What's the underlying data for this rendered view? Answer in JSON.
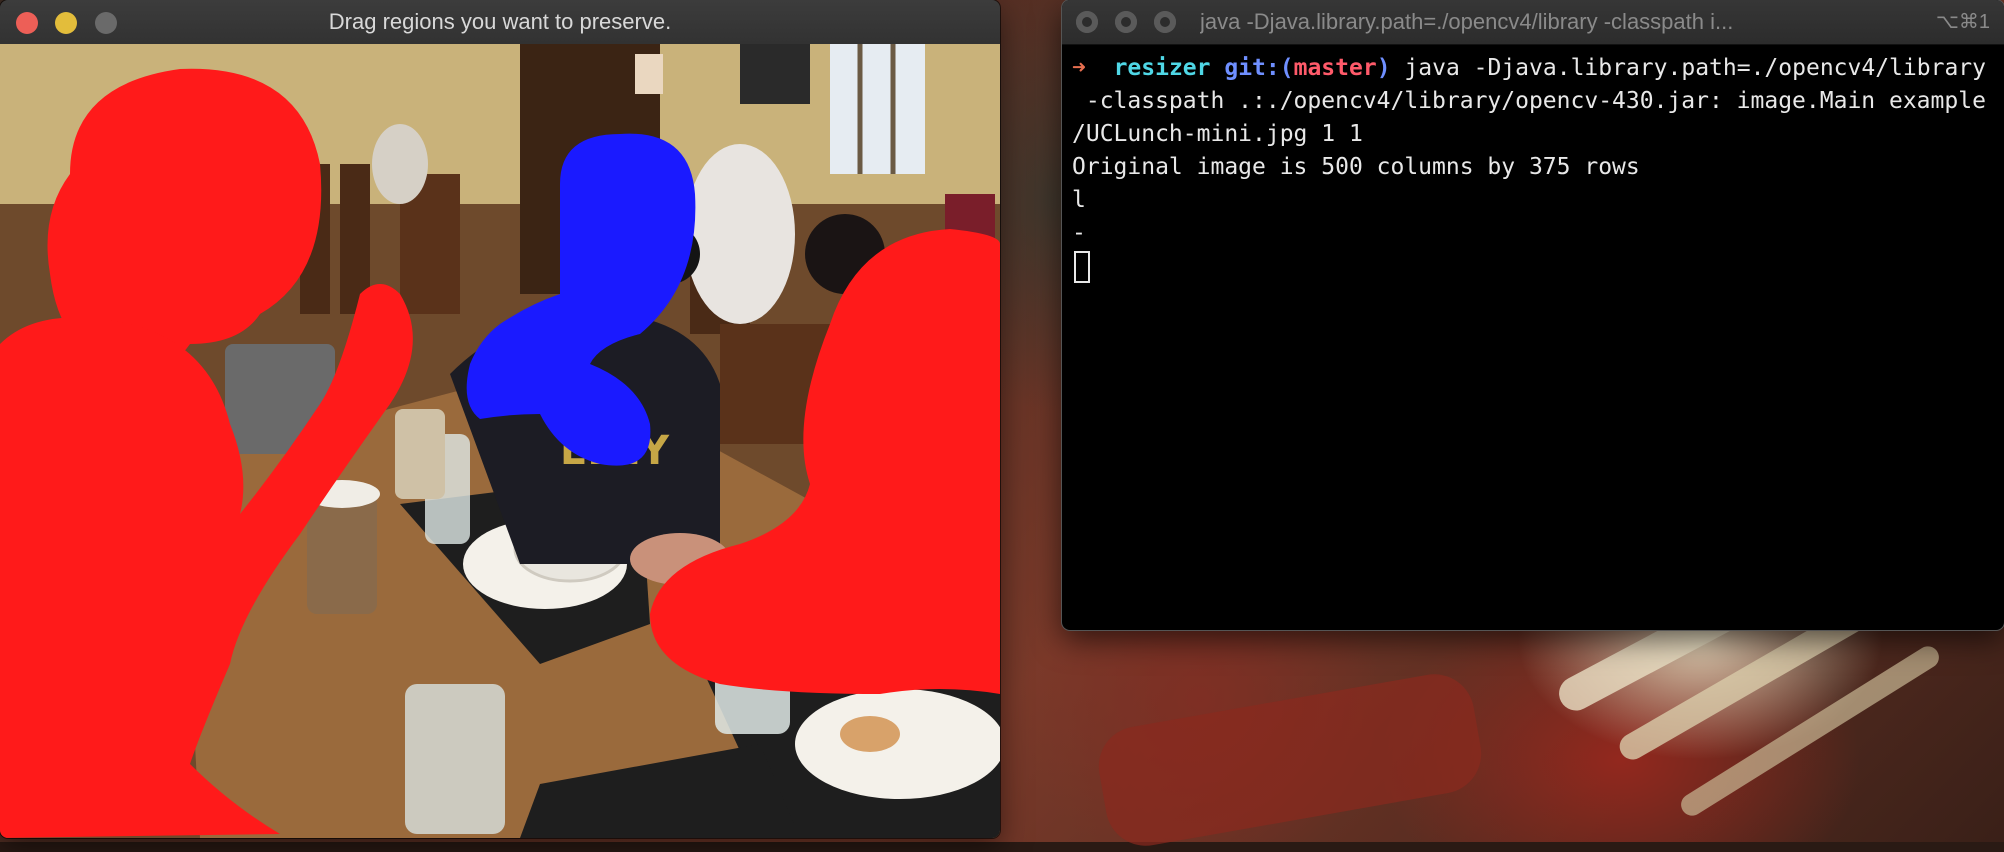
{
  "image_window": {
    "title": "Drag regions you want to preserve.",
    "traffic_colors": {
      "close": "#ed5f57",
      "minimize": "#e3bd3b",
      "zoom": "#6a6a6a"
    },
    "mask_colors": {
      "preserve": "#ff1a1a",
      "remove": "#1a1aff"
    }
  },
  "terminal": {
    "title": "java -Djava.library.path=./opencv4/library -classpath  i...",
    "shortcut": "⌥⌘1",
    "prompt": {
      "arrow": "➜",
      "directory": "resizer",
      "git_label": "git:(",
      "branch": "master",
      "git_close": ")"
    },
    "lines": [
      " java -Djava.library.path=./opencv4/library",
      " -classpath .:./opencv4/library/opencv-430.jar: image.Main example",
      "/UCLunch-mini.jpg 1 1",
      "Original image is 500 columns by 375 rows",
      "l",
      "-"
    ]
  }
}
